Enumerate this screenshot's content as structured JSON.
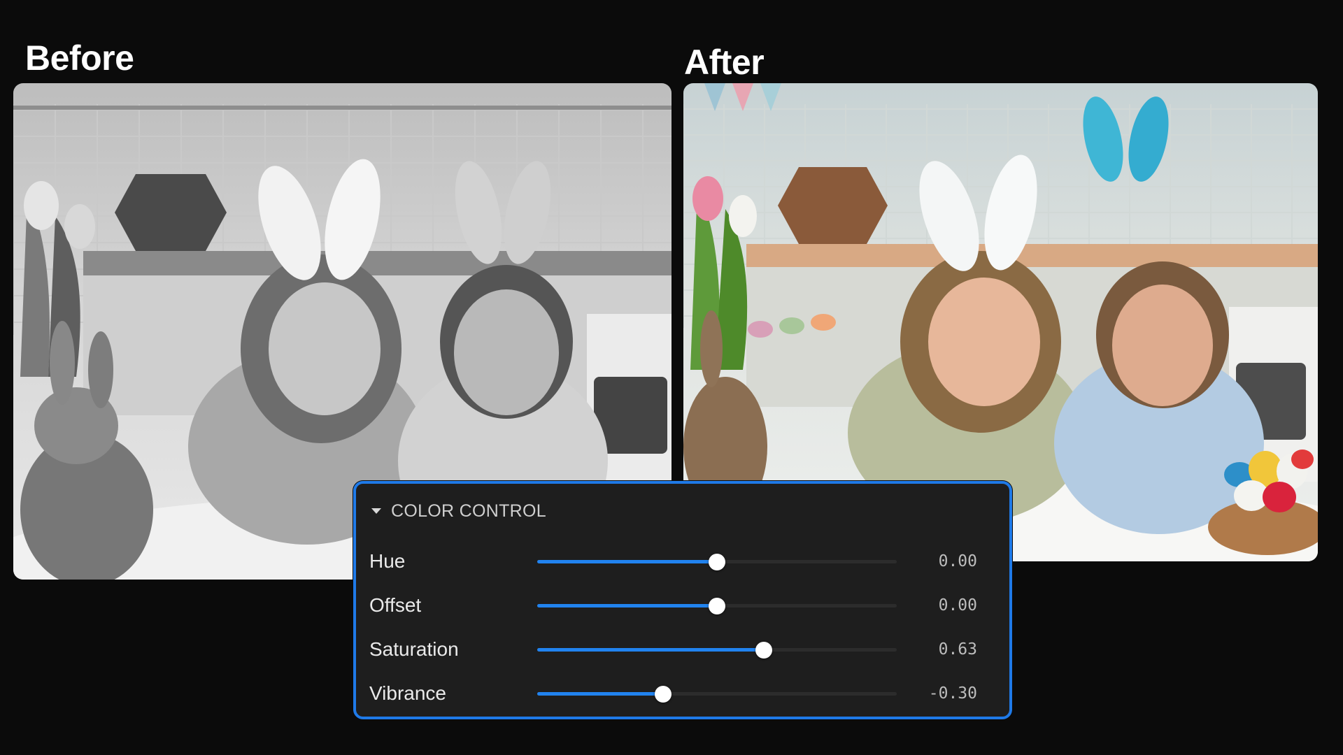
{
  "labels": {
    "before": "Before",
    "after": "After"
  },
  "panel": {
    "title": "COLOR CONTROL",
    "accent": "#1f7ae8",
    "controls": [
      {
        "label": "Hue",
        "value": "0.00",
        "level": 0.5
      },
      {
        "label": "Offset",
        "value": "0.00",
        "level": 0.5
      },
      {
        "label": "Saturation",
        "value": "0.63",
        "level": 0.63
      },
      {
        "label": "Vibrance",
        "value": "-0.30",
        "level": 0.35
      }
    ]
  },
  "icons": {
    "collapse": "triangle-down-icon"
  }
}
